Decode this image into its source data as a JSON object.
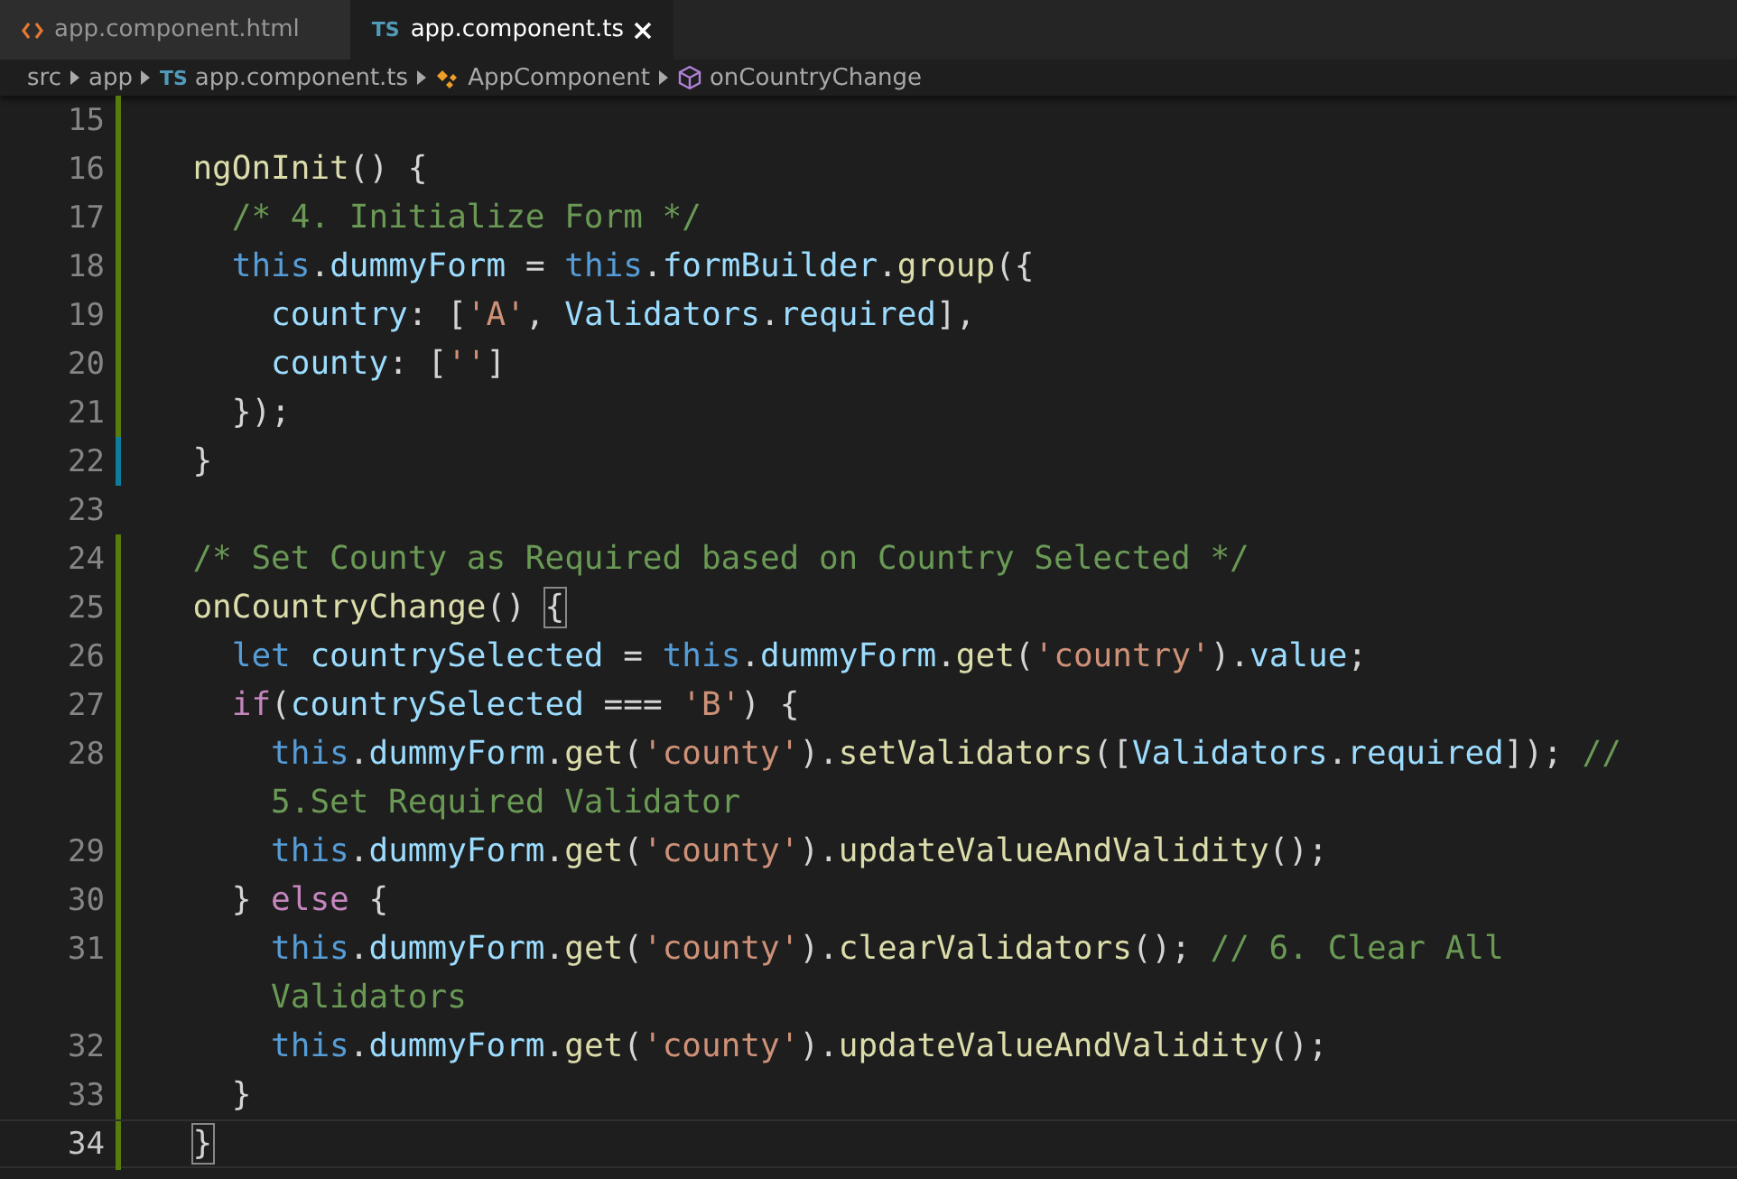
{
  "tabs": [
    {
      "kind": "html",
      "label": "app.component.html",
      "selected": false
    },
    {
      "kind": "ts",
      "badge": "TS",
      "label": "app.component.ts",
      "selected": true
    }
  ],
  "breadcrumbs": [
    {
      "kind": "folder",
      "label": "src"
    },
    {
      "kind": "folder",
      "label": "app"
    },
    {
      "kind": "file",
      "badge": "TS",
      "label": "app.component.ts"
    },
    {
      "kind": "class",
      "label": "AppComponent"
    },
    {
      "kind": "method",
      "label": "onCountryChange"
    }
  ],
  "lines": [
    {
      "number": "15",
      "added": true,
      "modified": false,
      "current": false
    },
    {
      "number": "16",
      "added": true,
      "modified": false,
      "current": false,
      "tokens": [
        {
          "kind": "fn",
          "text": "  ngOnInit"
        },
        {
          "kind": "p",
          "text": "() {"
        }
      ]
    },
    {
      "number": "17",
      "added": true,
      "modified": false,
      "current": false,
      "tokens": [
        {
          "kind": "cm",
          "text": "    /* 4. Initialize Form */"
        }
      ]
    },
    {
      "number": "18",
      "added": true,
      "modified": false,
      "current": false,
      "tokens": [
        {
          "kind": "kw",
          "text": "    this"
        },
        {
          "kind": "p",
          "text": "."
        },
        {
          "kind": "pr",
          "text": "dummyForm"
        },
        {
          "kind": "p",
          "text": " = "
        },
        {
          "kind": "kw",
          "text": "this"
        },
        {
          "kind": "p",
          "text": "."
        },
        {
          "kind": "pr",
          "text": "formBuilder"
        },
        {
          "kind": "p",
          "text": "."
        },
        {
          "kind": "fn",
          "text": "group"
        },
        {
          "kind": "p",
          "text": "({"
        }
      ]
    },
    {
      "number": "19",
      "added": true,
      "modified": false,
      "current": false,
      "tokens": [
        {
          "kind": "pr",
          "text": "      country"
        },
        {
          "kind": "p",
          "text": ": ["
        },
        {
          "kind": "st",
          "text": "'A'"
        },
        {
          "kind": "p",
          "text": ", "
        },
        {
          "kind": "pr",
          "text": "Validators"
        },
        {
          "kind": "p",
          "text": "."
        },
        {
          "kind": "pr",
          "text": "required"
        },
        {
          "kind": "p",
          "text": "],"
        }
      ]
    },
    {
      "number": "20",
      "added": true,
      "modified": false,
      "current": false,
      "tokens": [
        {
          "kind": "pr",
          "text": "      county"
        },
        {
          "kind": "p",
          "text": ": ["
        },
        {
          "kind": "st",
          "text": "''"
        },
        {
          "kind": "p",
          "text": "]"
        }
      ]
    },
    {
      "number": "21",
      "added": true,
      "modified": false,
      "current": false,
      "tokens": [
        {
          "kind": "p",
          "text": "    });"
        }
      ]
    },
    {
      "number": "22",
      "added": false,
      "modified": true,
      "current": false,
      "tokens": [
        {
          "kind": "p",
          "text": "  }"
        }
      ]
    },
    {
      "number": "23",
      "added": false,
      "modified": false,
      "current": false
    },
    {
      "number": "24",
      "added": true,
      "modified": false,
      "current": false,
      "tokens": [
        {
          "kind": "cm",
          "text": "  /* Set County as Required based on Country Selected */"
        }
      ]
    },
    {
      "number": "25",
      "added": true,
      "modified": false,
      "current": false,
      "tokens": [
        {
          "kind": "fn",
          "text": "  onCountryChange"
        },
        {
          "kind": "p",
          "text": "() "
        },
        {
          "kind": "bm",
          "text": "{"
        }
      ]
    },
    {
      "number": "26",
      "added": true,
      "modified": false,
      "current": false,
      "tokens": [
        {
          "kind": "kw",
          "text": "    let"
        },
        {
          "kind": "pr",
          "text": " countrySelected"
        },
        {
          "kind": "p",
          "text": " = "
        },
        {
          "kind": "kw",
          "text": "this"
        },
        {
          "kind": "p",
          "text": "."
        },
        {
          "kind": "pr",
          "text": "dummyForm"
        },
        {
          "kind": "p",
          "text": "."
        },
        {
          "kind": "fn",
          "text": "get"
        },
        {
          "kind": "p",
          "text": "("
        },
        {
          "kind": "st",
          "text": "'country'"
        },
        {
          "kind": "p",
          "text": ")."
        },
        {
          "kind": "pr",
          "text": "value"
        },
        {
          "kind": "p",
          "text": ";"
        }
      ]
    },
    {
      "number": "27",
      "added": true,
      "modified": false,
      "current": false,
      "tokens": [
        {
          "kind": "ctl",
          "text": "    if"
        },
        {
          "kind": "p",
          "text": "("
        },
        {
          "kind": "pr",
          "text": "countrySelected"
        },
        {
          "kind": "p",
          "text": " === "
        },
        {
          "kind": "st",
          "text": "'B'"
        },
        {
          "kind": "p",
          "text": ") {"
        }
      ]
    },
    {
      "number": "28",
      "added": true,
      "modified": false,
      "current": false,
      "tokens": [
        {
          "kind": "kw",
          "text": "      this"
        },
        {
          "kind": "p",
          "text": "."
        },
        {
          "kind": "pr",
          "text": "dummyForm"
        },
        {
          "kind": "p",
          "text": "."
        },
        {
          "kind": "fn",
          "text": "get"
        },
        {
          "kind": "p",
          "text": "("
        },
        {
          "kind": "st",
          "text": "'county'"
        },
        {
          "kind": "p",
          "text": ")."
        },
        {
          "kind": "fn",
          "text": "setValidators"
        },
        {
          "kind": "p",
          "text": "(["
        },
        {
          "kind": "pr",
          "text": "Validators"
        },
        {
          "kind": "p",
          "text": "."
        },
        {
          "kind": "pr",
          "text": "required"
        },
        {
          "kind": "p",
          "text": "]); "
        },
        {
          "kind": "cm",
          "text": "//"
        }
      ],
      "continuation": [
        {
          "kind": "cm",
          "text": "      5.Set Required Validator"
        }
      ]
    },
    {
      "number": "29",
      "added": true,
      "modified": false,
      "current": false,
      "tokens": [
        {
          "kind": "kw",
          "text": "      this"
        },
        {
          "kind": "p",
          "text": "."
        },
        {
          "kind": "pr",
          "text": "dummyForm"
        },
        {
          "kind": "p",
          "text": "."
        },
        {
          "kind": "fn",
          "text": "get"
        },
        {
          "kind": "p",
          "text": "("
        },
        {
          "kind": "st",
          "text": "'county'"
        },
        {
          "kind": "p",
          "text": ")."
        },
        {
          "kind": "fn",
          "text": "updateValueAndValidity"
        },
        {
          "kind": "p",
          "text": "();"
        }
      ]
    },
    {
      "number": "30",
      "added": true,
      "modified": false,
      "current": false,
      "tokens": [
        {
          "kind": "p",
          "text": "    } "
        },
        {
          "kind": "ctl",
          "text": "else"
        },
        {
          "kind": "p",
          "text": " {"
        }
      ]
    },
    {
      "number": "31",
      "added": true,
      "modified": false,
      "current": false,
      "tokens": [
        {
          "kind": "kw",
          "text": "      this"
        },
        {
          "kind": "p",
          "text": "."
        },
        {
          "kind": "pr",
          "text": "dummyForm"
        },
        {
          "kind": "p",
          "text": "."
        },
        {
          "kind": "fn",
          "text": "get"
        },
        {
          "kind": "p",
          "text": "("
        },
        {
          "kind": "st",
          "text": "'county'"
        },
        {
          "kind": "p",
          "text": ")."
        },
        {
          "kind": "fn",
          "text": "clearValidators"
        },
        {
          "kind": "p",
          "text": "(); "
        },
        {
          "kind": "cm",
          "text": "// 6. Clear All"
        }
      ],
      "continuation": [
        {
          "kind": "cm",
          "text": "      Validators"
        }
      ]
    },
    {
      "number": "32",
      "added": true,
      "modified": false,
      "current": false,
      "tokens": [
        {
          "kind": "kw",
          "text": "      this"
        },
        {
          "kind": "p",
          "text": "."
        },
        {
          "kind": "pr",
          "text": "dummyForm"
        },
        {
          "kind": "p",
          "text": "."
        },
        {
          "kind": "fn",
          "text": "get"
        },
        {
          "kind": "p",
          "text": "("
        },
        {
          "kind": "st",
          "text": "'county'"
        },
        {
          "kind": "p",
          "text": ")."
        },
        {
          "kind": "fn",
          "text": "updateValueAndValidity"
        },
        {
          "kind": "p",
          "text": "();"
        }
      ]
    },
    {
      "number": "33",
      "added": true,
      "modified": false,
      "current": false,
      "tokens": [
        {
          "kind": "p",
          "text": "    }"
        }
      ]
    },
    {
      "number": "34",
      "added": true,
      "modified": false,
      "current": true,
      "tokens": [
        {
          "kind": "bm",
          "text": "  }"
        }
      ]
    }
  ]
}
